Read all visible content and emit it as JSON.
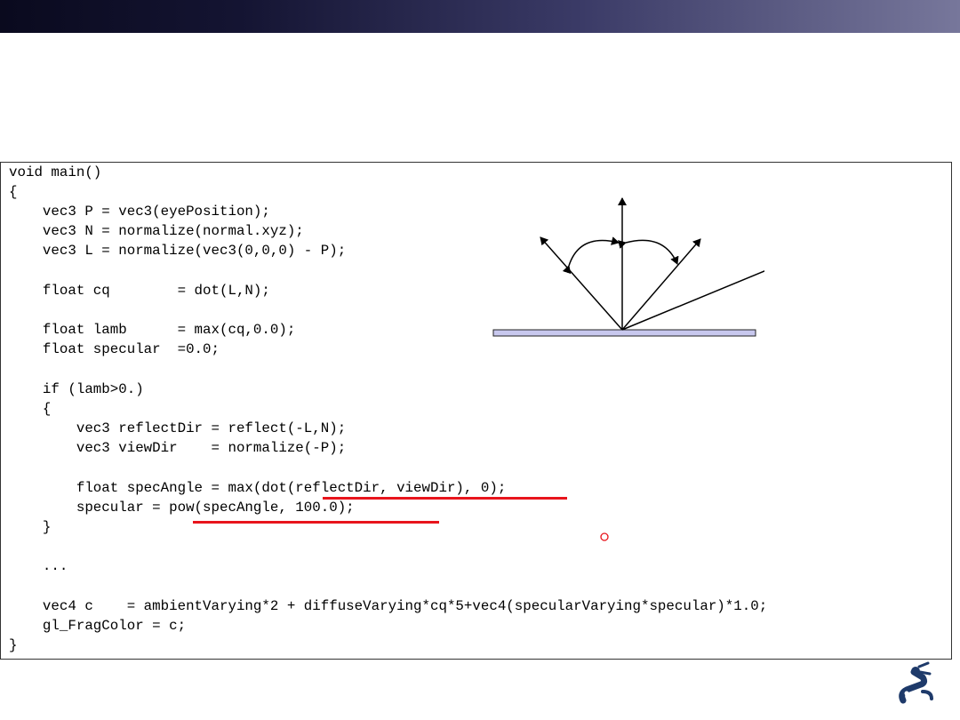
{
  "code": {
    "lines": [
      "void main()",
      "{",
      "    vec3 P = vec3(eyePosition);",
      "    vec3 N = normalize(normal.xyz);",
      "    vec3 L = normalize(vec3(0,0,0) - P);",
      "",
      "    float cq        = dot(L,N);",
      "",
      "    float lamb      = max(cq,0.0);",
      "    float specular  =0.0;",
      "",
      "    if (lamb>0.)",
      "    {",
      "        vec3 reflectDir = reflect(-L,N);",
      "        vec3 viewDir    = normalize(-P);",
      "",
      "        float specAngle = max(dot(reflectDir, viewDir), 0);",
      "        specular = pow(specAngle, 100.0);",
      "    }",
      "",
      "    ...",
      "",
      "    vec4 c    = ambientVarying*2 + diffuseVarying*cq*5+vec4(specularVarying*specular)*1.0;",
      "    gl_FragColor = c;",
      "}"
    ]
  },
  "colors": {
    "accent_red": "#e8141c",
    "surface_fill": "#c8c8ee",
    "header_dark": "#0a0a1e",
    "header_light": "#77779b"
  }
}
